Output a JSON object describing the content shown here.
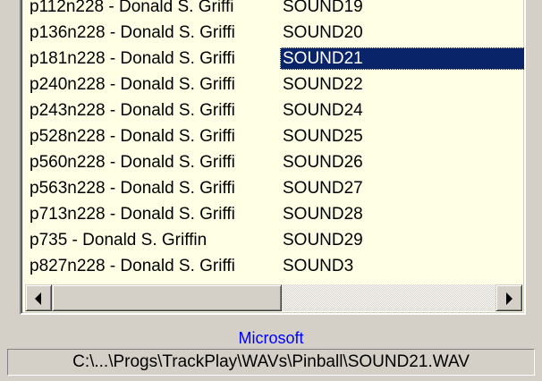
{
  "list": {
    "rows": [
      {
        "name": "p112n228 - Donald S. Griffi",
        "sound": "SOUND19",
        "selected": false
      },
      {
        "name": "p136n228 - Donald S. Griffi",
        "sound": "SOUND20",
        "selected": false
      },
      {
        "name": "p181n228 - Donald S. Griffi",
        "sound": "SOUND21",
        "selected": true
      },
      {
        "name": "p240n228 - Donald S. Griffi",
        "sound": "SOUND22",
        "selected": false
      },
      {
        "name": "p243n228 - Donald S. Griffi",
        "sound": "SOUND24",
        "selected": false
      },
      {
        "name": "p528n228 - Donald S. Griffi",
        "sound": "SOUND25",
        "selected": false
      },
      {
        "name": "p560n228 - Donald S. Griffi",
        "sound": "SOUND26",
        "selected": false
      },
      {
        "name": "p563n228 - Donald S. Griffi",
        "sound": "SOUND27",
        "selected": false
      },
      {
        "name": "p713n228 - Donald S. Griffi",
        "sound": "SOUND28",
        "selected": false
      },
      {
        "name": "p735 - Donald S. Griffin",
        "sound": "SOUND29",
        "selected": false
      },
      {
        "name": "p827n228 - Donald S. Griffi",
        "sound": "SOUND3",
        "selected": false
      }
    ]
  },
  "scrollbar": {
    "left_icon": "arrow-left-icon",
    "right_icon": "arrow-right-icon"
  },
  "owner_label": "Microsoft",
  "path_label": "C:\\...\\Progs\\TrackPlay\\WAVs\\Pinball\\SOUND21.WAV",
  "colors": {
    "list_background": "#ffffe6",
    "selection": "#0a246a",
    "owner_text": "#0000ff",
    "window": "#d4d0c8"
  }
}
